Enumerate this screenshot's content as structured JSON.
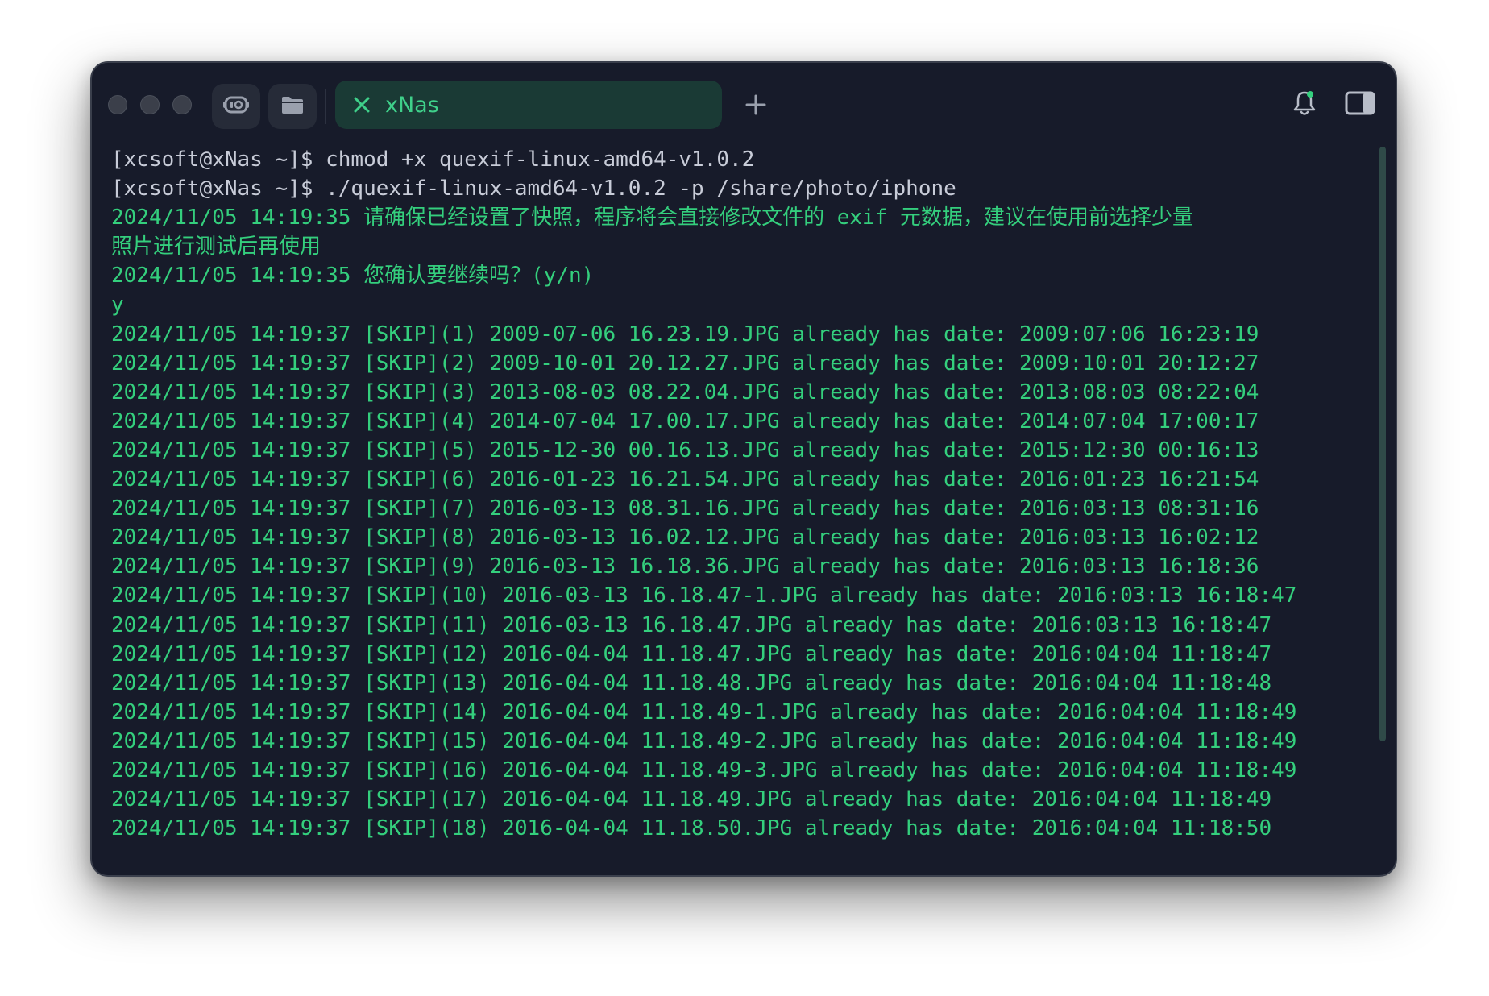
{
  "window": {
    "tab_title": "xNas"
  },
  "icons": {
    "ai": "ai-assistant-icon",
    "folder": "folder-icon",
    "close": "close-icon",
    "add": "plus-icon",
    "bell": "bell-icon",
    "sidebar": "sidebar-toggle-icon"
  },
  "colors": {
    "background": "#171b2a",
    "prompt_text": "#c8ccd8",
    "output_text": "#34cf7d",
    "tab_background": "#1a3a35"
  },
  "terminal": {
    "lines": [
      {
        "type": "prompt",
        "text": "[xcsoft@xNas ~]$ chmod +x quexif-linux-amd64-v1.0.2"
      },
      {
        "type": "prompt",
        "text": "[xcsoft@xNas ~]$ ./quexif-linux-amd64-v1.0.2 -p /share/photo/iphone"
      },
      {
        "type": "output",
        "text": "2024/11/05 14:19:35 请确保已经设置了快照，程序将会直接修改文件的 exif 元数据，建议在使用前选择少量"
      },
      {
        "type": "output",
        "text": "照片进行测试后再使用"
      },
      {
        "type": "output",
        "text": "2024/11/05 14:19:35 您确认要继续吗？(y/n)"
      },
      {
        "type": "output",
        "text": "y"
      },
      {
        "type": "output",
        "text": "2024/11/05 14:19:37 [SKIP](1) 2009-07-06 16.23.19.JPG already has date: 2009:07:06 16:23:19"
      },
      {
        "type": "output",
        "text": "2024/11/05 14:19:37 [SKIP](2) 2009-10-01 20.12.27.JPG already has date: 2009:10:01 20:12:27"
      },
      {
        "type": "output",
        "text": "2024/11/05 14:19:37 [SKIP](3) 2013-08-03 08.22.04.JPG already has date: 2013:08:03 08:22:04"
      },
      {
        "type": "output",
        "text": "2024/11/05 14:19:37 [SKIP](4) 2014-07-04 17.00.17.JPG already has date: 2014:07:04 17:00:17"
      },
      {
        "type": "output",
        "text": "2024/11/05 14:19:37 [SKIP](5) 2015-12-30 00.16.13.JPG already has date: 2015:12:30 00:16:13"
      },
      {
        "type": "output",
        "text": "2024/11/05 14:19:37 [SKIP](6) 2016-01-23 16.21.54.JPG already has date: 2016:01:23 16:21:54"
      },
      {
        "type": "output",
        "text": "2024/11/05 14:19:37 [SKIP](7) 2016-03-13 08.31.16.JPG already has date: 2016:03:13 08:31:16"
      },
      {
        "type": "output",
        "text": "2024/11/05 14:19:37 [SKIP](8) 2016-03-13 16.02.12.JPG already has date: 2016:03:13 16:02:12"
      },
      {
        "type": "output",
        "text": "2024/11/05 14:19:37 [SKIP](9) 2016-03-13 16.18.36.JPG already has date: 2016:03:13 16:18:36"
      },
      {
        "type": "output",
        "text": "2024/11/05 14:19:37 [SKIP](10) 2016-03-13 16.18.47-1.JPG already has date: 2016:03:13 16:18:47"
      },
      {
        "type": "output",
        "text": "2024/11/05 14:19:37 [SKIP](11) 2016-03-13 16.18.47.JPG already has date: 2016:03:13 16:18:47"
      },
      {
        "type": "output",
        "text": "2024/11/05 14:19:37 [SKIP](12) 2016-04-04 11.18.47.JPG already has date: 2016:04:04 11:18:47"
      },
      {
        "type": "output",
        "text": "2024/11/05 14:19:37 [SKIP](13) 2016-04-04 11.18.48.JPG already has date: 2016:04:04 11:18:48"
      },
      {
        "type": "output",
        "text": "2024/11/05 14:19:37 [SKIP](14) 2016-04-04 11.18.49-1.JPG already has date: 2016:04:04 11:18:49"
      },
      {
        "type": "output",
        "text": "2024/11/05 14:19:37 [SKIP](15) 2016-04-04 11.18.49-2.JPG already has date: 2016:04:04 11:18:49"
      },
      {
        "type": "output",
        "text": "2024/11/05 14:19:37 [SKIP](16) 2016-04-04 11.18.49-3.JPG already has date: 2016:04:04 11:18:49"
      },
      {
        "type": "output",
        "text": "2024/11/05 14:19:37 [SKIP](17) 2016-04-04 11.18.49.JPG already has date: 2016:04:04 11:18:49"
      },
      {
        "type": "output",
        "text": "2024/11/05 14:19:37 [SKIP](18) 2016-04-04 11.18.50.JPG already has date: 2016:04:04 11:18:50"
      }
    ]
  }
}
